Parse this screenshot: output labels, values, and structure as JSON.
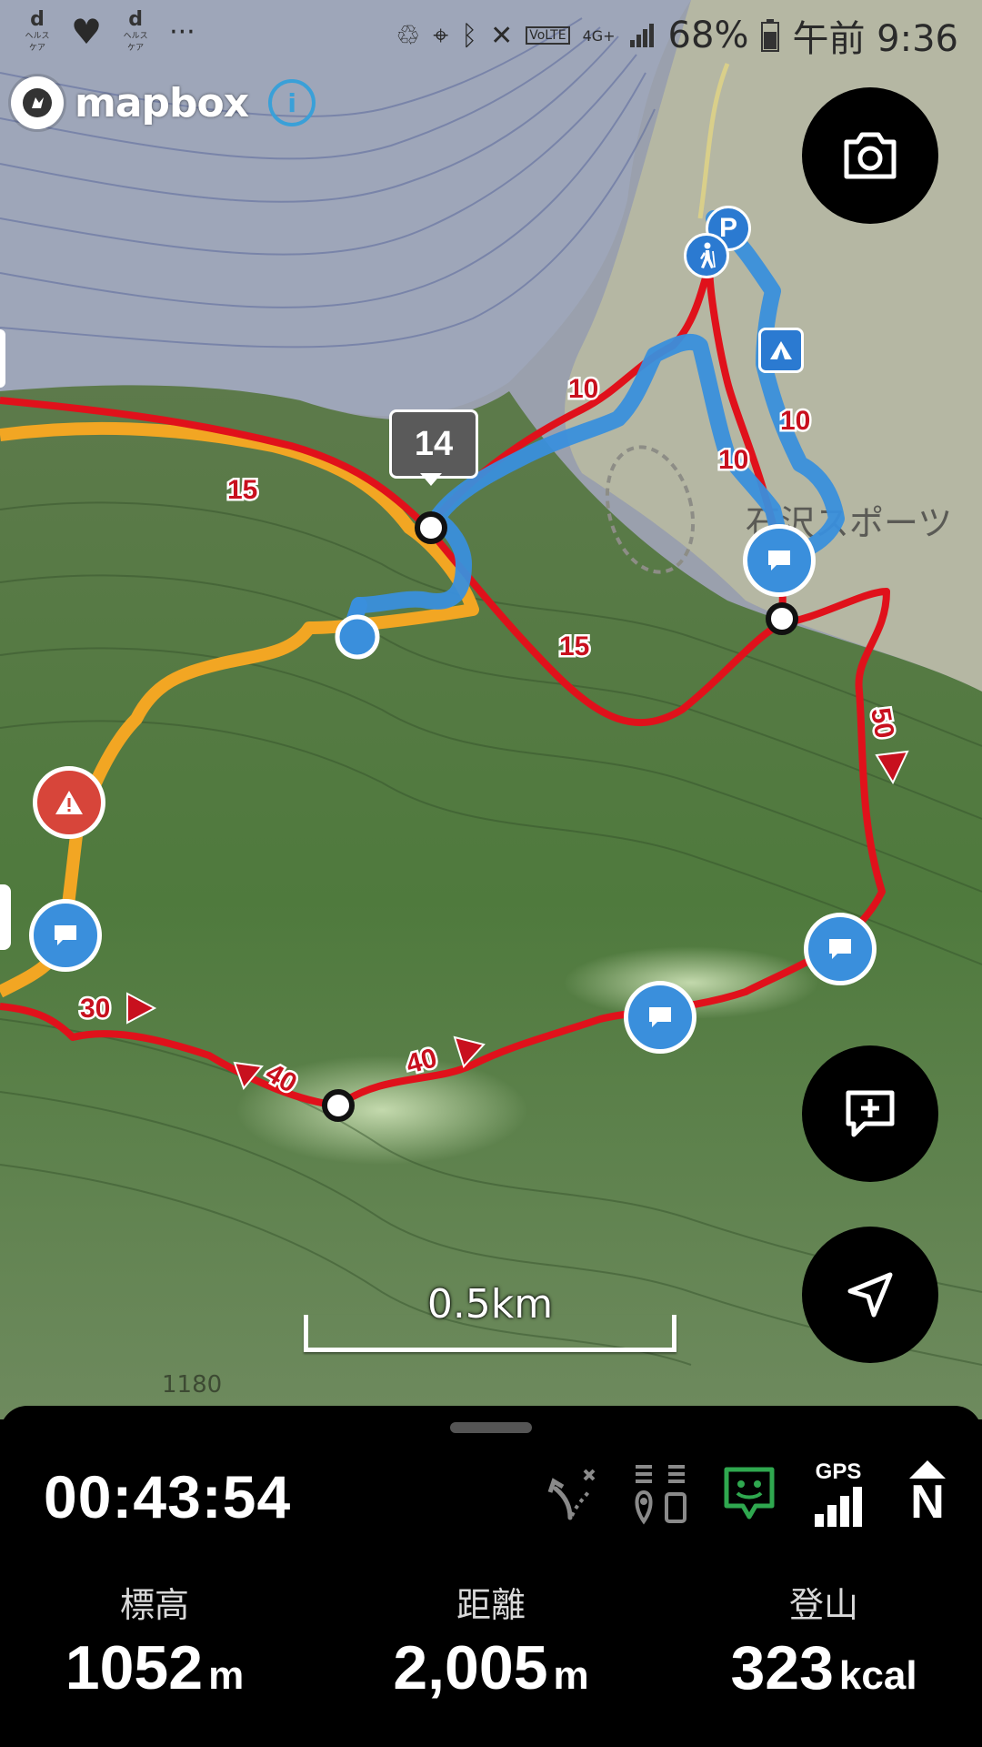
{
  "status_bar": {
    "battery_percent": "68%",
    "time": "午前 9:36",
    "network": "4G+",
    "volte": "VoLTE",
    "app_icon_labels": [
      "ヘルスケア",
      "ヘルスケア"
    ],
    "overflow": "···"
  },
  "map": {
    "provider": "mapbox",
    "info_glyph": "i",
    "waypoint_label": "14",
    "scale_label": "0.5km",
    "contour_label": "1180",
    "place_text": "石沢スポーツ",
    "segment_times": [
      "15",
      "10",
      "10",
      "10",
      "15",
      "50",
      "30",
      "40",
      "40"
    ],
    "colors": {
      "planned_route": "#e0111b",
      "track": "#3a8fdc",
      "alt_route": "#f2a623"
    }
  },
  "buttons": {
    "camera": "camera-icon",
    "add_memo": "add-memo-icon",
    "locate": "navigate-icon"
  },
  "panel": {
    "elapsed": "00:43:54",
    "gps_label": "GPS",
    "compass_label": "N",
    "stats": [
      {
        "label": "標高",
        "value": "1052",
        "unit": "m"
      },
      {
        "label": "距離",
        "value": "2,005",
        "unit": "m"
      },
      {
        "label": "登山",
        "value": "323",
        "unit": "kcal"
      }
    ]
  }
}
